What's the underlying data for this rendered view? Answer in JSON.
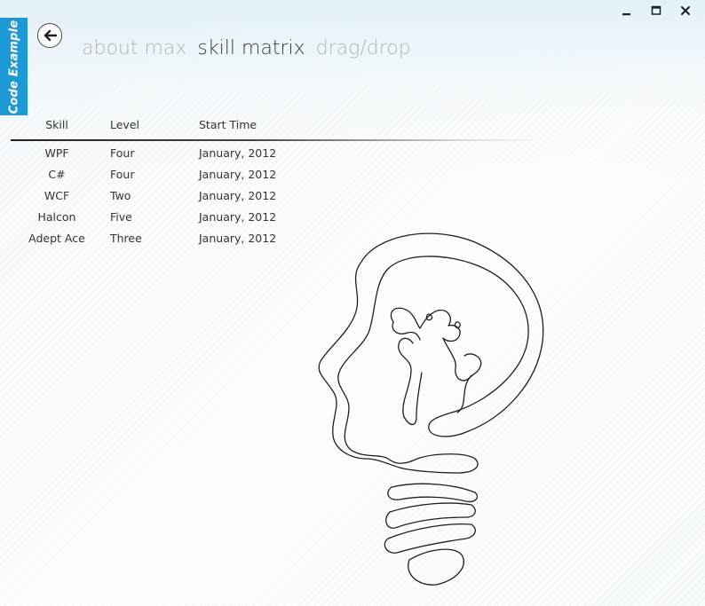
{
  "app": {
    "side_tab_label": "Code Example"
  },
  "window": {
    "minimize_icon": "minimize-icon",
    "maximize_icon": "maximize-icon",
    "close_icon": "close-icon"
  },
  "back_button": {
    "icon": "back-arrow-icon"
  },
  "nav": {
    "items": [
      {
        "label": "about max",
        "active": false
      },
      {
        "label": "skill matrix",
        "active": true
      },
      {
        "label": "drag/drop",
        "active": false
      }
    ]
  },
  "table": {
    "headers": {
      "skill": "Skill",
      "level": "Level",
      "start_time": "Start Time"
    },
    "rows": [
      {
        "skill": "WPF",
        "level": "Four",
        "start_time": "January, 2012"
      },
      {
        "skill": "C#",
        "level": "Four",
        "start_time": "January, 2012"
      },
      {
        "skill": "WCF",
        "level": "Two",
        "start_time": "January, 2012"
      },
      {
        "skill": "Halcon",
        "level": "Five",
        "start_time": "January, 2012"
      },
      {
        "skill": "Adept Ace",
        "level": "Three",
        "start_time": "January, 2012"
      }
    ]
  },
  "illustration": {
    "icon": "lightbulb-head-icon"
  },
  "colors": {
    "accent": "#1d9ad6",
    "nav_inactive": "#b5b5b5",
    "nav_active": "#3a3a3a"
  }
}
